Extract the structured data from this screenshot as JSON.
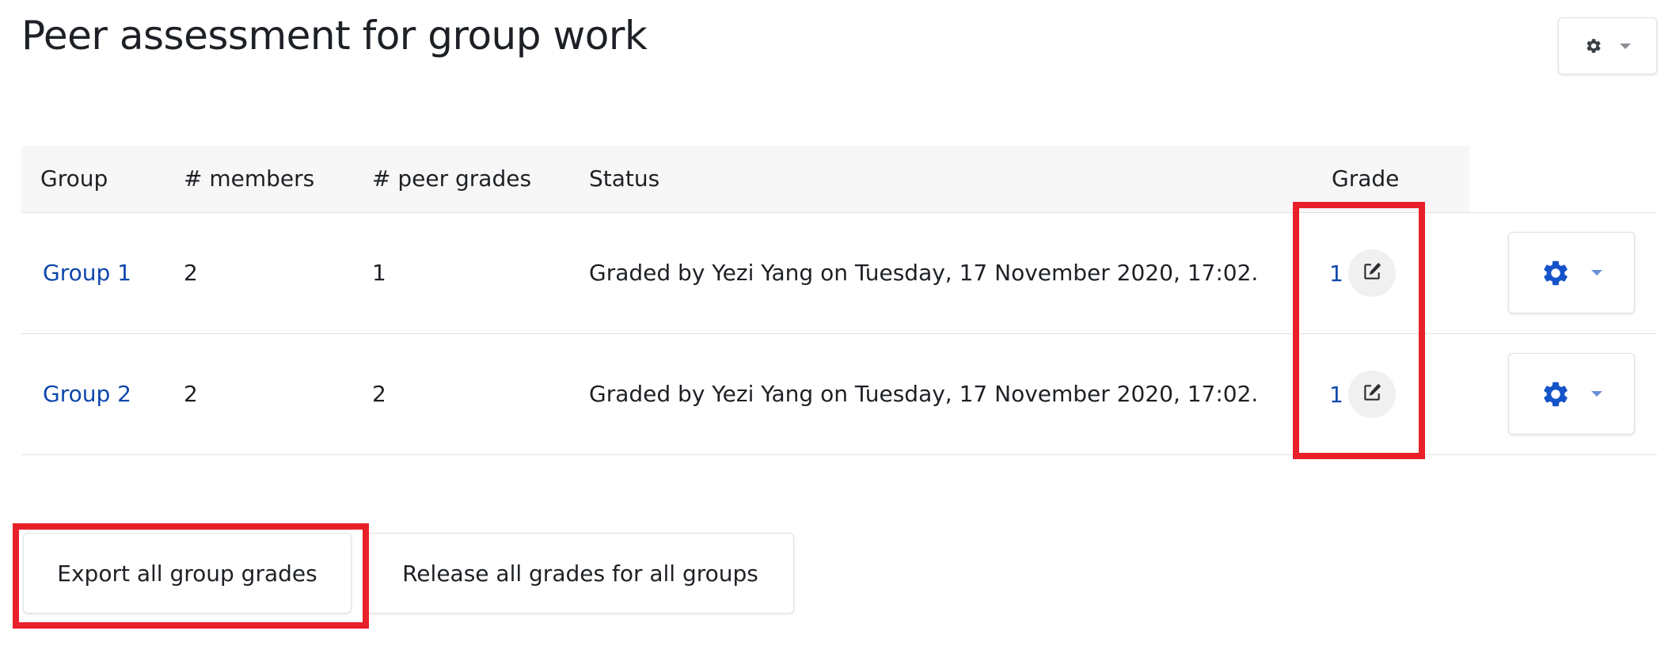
{
  "page": {
    "title": "Peer assessment for group work"
  },
  "table": {
    "headers": {
      "group": "Group",
      "members": "# members",
      "peer_grades": "# peer grades",
      "status": "Status",
      "grade": "Grade"
    },
    "rows": [
      {
        "group": "Group 1",
        "members": "2",
        "peer_grades": "1",
        "status": "Graded by Yezi Yang on Tuesday, 17 November 2020, 17:02.",
        "grade": "1"
      },
      {
        "group": "Group 2",
        "members": "2",
        "peer_grades": "2",
        "status": "Graded by Yezi Yang on Tuesday, 17 November 2020, 17:02.",
        "grade": "1"
      }
    ]
  },
  "buttons": {
    "export": "Export all group grades",
    "release": "Release all grades for all groups"
  },
  "icons": {
    "page_actions": "gear-icon",
    "row_actions": "gear-icon",
    "edit_grade": "edit-icon"
  },
  "colors": {
    "link": "#0f47ad",
    "highlight": "#e8202a",
    "header_bg": "#f7f7f7"
  }
}
